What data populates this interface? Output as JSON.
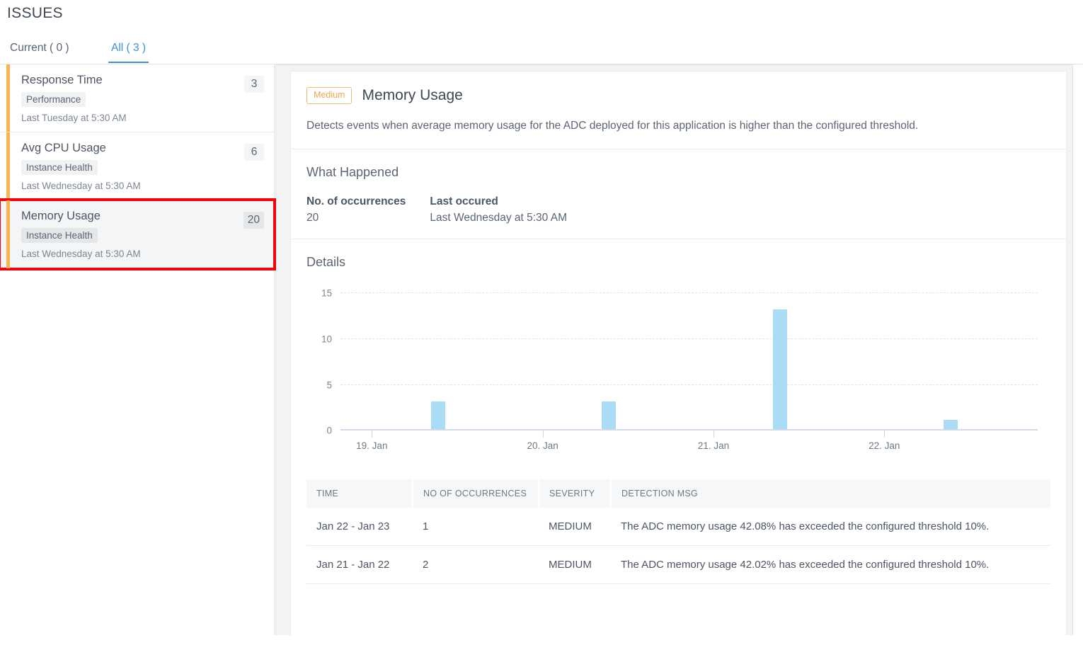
{
  "header": {
    "title": "ISSUES"
  },
  "tabs": [
    {
      "label": "Current ( 0 )",
      "active": false
    },
    {
      "label": "All ( 3 )",
      "active": true
    }
  ],
  "issues_list": [
    {
      "name": "Response Time",
      "count": "3",
      "tag": "Performance",
      "time": "Last Tuesday at 5:30 AM",
      "selected": false,
      "accent_color": "#f7b34c"
    },
    {
      "name": "Avg CPU Usage",
      "count": "6",
      "tag": "Instance Health",
      "time": "Last Wednesday at 5:30 AM",
      "selected": false,
      "accent_color": "#f7b34c"
    },
    {
      "name": "Memory Usage",
      "count": "20",
      "tag": "Instance Health",
      "time": "Last Wednesday at 5:30 AM",
      "selected": true,
      "accent_color": "#f7b34c",
      "highlight_color": "#fb0007"
    }
  ],
  "detail": {
    "severity_badge": "Medium",
    "title": "Memory Usage",
    "description": "Detects events when average memory usage for the ADC deployed for this application is higher than the configured threshold.",
    "what_happened": {
      "heading": "What Happened",
      "fields": [
        {
          "label": "No. of occurrences",
          "value": "20"
        },
        {
          "label": "Last occured",
          "value": "Last Wednesday at 5:30 AM"
        }
      ]
    },
    "details": {
      "heading": "Details"
    },
    "table": {
      "columns": [
        "TIME",
        "NO OF OCCURRENCES",
        "SEVERITY",
        "DETECTION MSG"
      ],
      "rows": [
        {
          "time": "Jan 22 - Jan 23",
          "occurrences": "1",
          "severity": "MEDIUM",
          "message": "The ADC memory usage 42.08% has exceeded the configured threshold 10%."
        },
        {
          "time": "Jan 21 - Jan 22",
          "occurrences": "2",
          "severity": "MEDIUM",
          "message": "The ADC memory usage 42.02% has exceeded the configured threshold 10%."
        }
      ]
    }
  },
  "chart_data": {
    "type": "bar",
    "title": "Details",
    "xlabel": "",
    "ylabel": "",
    "ylim": [
      0,
      15
    ],
    "yticks": [
      0,
      5,
      10,
      15
    ],
    "grid": true,
    "legend": "none",
    "bar_color": "#aadcf5",
    "categories": [
      "19. Jan",
      "20. Jan",
      "21. Jan",
      "22. Jan"
    ],
    "x_tick_positions_pct": [
      4.5,
      29.0,
      53.5,
      78.0
    ],
    "values": [
      3,
      3,
      13,
      1
    ],
    "bar_positions_pct": [
      13.0,
      37.5,
      62.0,
      86.5
    ]
  }
}
